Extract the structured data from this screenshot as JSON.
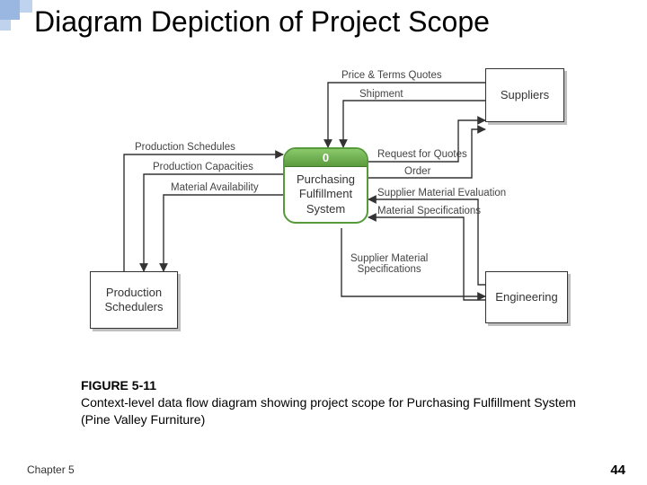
{
  "title": "Diagram Depiction of Project Scope",
  "entities": {
    "suppliers": "Suppliers",
    "prod_sched": "Production\nSchedulers",
    "engineering": "Engineering"
  },
  "process": {
    "number": "0",
    "name": "Purchasing\nFulfillment\nSystem"
  },
  "flows": {
    "price_terms": "Price & Terms Quotes",
    "shipment": "Shipment",
    "request_quotes": "Request for Quotes",
    "order": "Order",
    "prod_schedules": "Production Schedules",
    "prod_capacities": "Production Capacities",
    "material_avail": "Material Availability",
    "supplier_eval": "Supplier Material Evaluation",
    "material_specs": "Material Specifications",
    "supplier_material_specs": "Supplier Material\nSpecifications"
  },
  "caption": {
    "figno": "FIGURE 5-11",
    "text": "Context-level data flow diagram showing project scope for Purchasing Fulfillment System (Pine Valley Furniture)"
  },
  "footer": {
    "chapter": "Chapter 5",
    "page": "44"
  },
  "chart_data": {
    "type": "diagram",
    "diagram_kind": "context-level-DFD",
    "process": {
      "id": "0",
      "name": "Purchasing Fulfillment System"
    },
    "external_entities": [
      "Suppliers",
      "Production Schedulers",
      "Engineering"
    ],
    "data_flows": [
      {
        "from": "Suppliers",
        "to": "Purchasing Fulfillment System",
        "label": "Price & Terms Quotes"
      },
      {
        "from": "Suppliers",
        "to": "Purchasing Fulfillment System",
        "label": "Shipment"
      },
      {
        "from": "Purchasing Fulfillment System",
        "to": "Suppliers",
        "label": "Request for Quotes"
      },
      {
        "from": "Purchasing Fulfillment System",
        "to": "Suppliers",
        "label": "Order"
      },
      {
        "from": "Production Schedulers",
        "to": "Purchasing Fulfillment System",
        "label": "Production Schedules"
      },
      {
        "from": "Purchasing Fulfillment System",
        "to": "Production Schedulers",
        "label": "Production Capacities"
      },
      {
        "from": "Purchasing Fulfillment System",
        "to": "Production Schedulers",
        "label": "Material Availability"
      },
      {
        "from": "Engineering",
        "to": "Purchasing Fulfillment System",
        "label": "Supplier Material Evaluation"
      },
      {
        "from": "Engineering",
        "to": "Purchasing Fulfillment System",
        "label": "Material Specifications"
      },
      {
        "from": "Purchasing Fulfillment System",
        "to": "Engineering",
        "label": "Supplier Material Specifications"
      }
    ]
  }
}
